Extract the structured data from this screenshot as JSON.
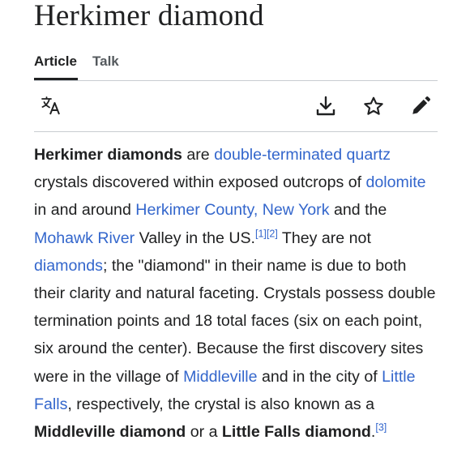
{
  "article": {
    "title": "Herkimer diamond"
  },
  "tabs": [
    {
      "label": "Article",
      "active": true
    },
    {
      "label": "Talk",
      "active": false
    }
  ],
  "toolbar": {
    "language_icon": "translate-icon",
    "download_icon": "download-icon",
    "watch_icon": "star-icon",
    "edit_icon": "pencil-icon"
  },
  "colors": {
    "link": "#3366cc",
    "text": "#202122",
    "rule": "#c8ccd1"
  },
  "paragraph": {
    "term": "Herkimer diamonds",
    "t1": " are ",
    "link_dtq": "double-terminated quartz",
    "t2": " crystals discovered within exposed outcrops of ",
    "link_dolomite": "dolomite",
    "t3": " in and around ",
    "link_county": "Herkimer County, New York",
    "t4": " and the ",
    "link_river": "Mohawk River",
    "t5": " Valley in the US.",
    "ref1": "[1]",
    "ref2": "[2]",
    "t6": " They are not ",
    "link_diamonds": "diamonds",
    "t7": "; the \"diamond\" in their name is due to both their clarity and natural faceting. Crystals possess double termination points and 18 total faces (six on each point, six around the center). Because the first discovery sites were in the village of ",
    "link_middleville": "Middleville",
    "t8": " and in the city of ",
    "link_littlefalls": "Little Falls",
    "t9": ", respectively, the crystal is also known as a ",
    "bold_middleville": "Middleville diamond",
    "t10": " or a ",
    "bold_littlefalls": "Little Falls diamond",
    "t11": ".",
    "ref3": "[3]"
  }
}
